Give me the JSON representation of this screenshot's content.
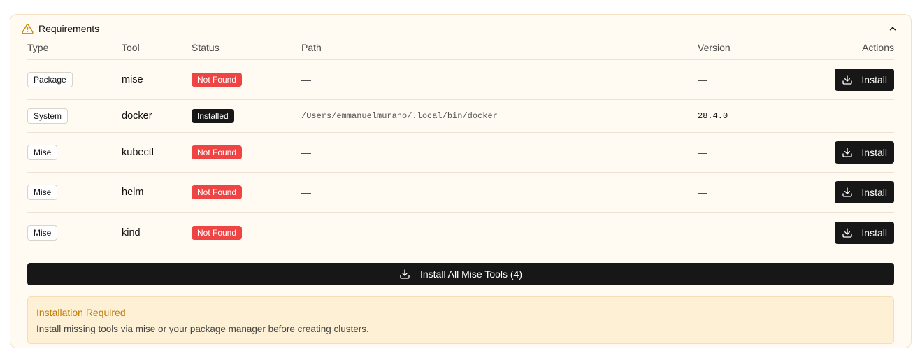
{
  "requirements": {
    "title": "Requirements",
    "columns": {
      "type": "Type",
      "tool": "Tool",
      "status": "Status",
      "path": "Path",
      "version": "Version",
      "actions": "Actions"
    },
    "rows": [
      {
        "type": "Package",
        "tool": "mise",
        "status": "Not Found",
        "path": "—",
        "version": "—",
        "action": "Install"
      },
      {
        "type": "System",
        "tool": "docker",
        "status": "Installed",
        "path": "/Users/emmanuelmurano/.local/bin/docker",
        "version": "28.4.0",
        "action": "—"
      },
      {
        "type": "Mise",
        "tool": "kubectl",
        "status": "Not Found",
        "path": "—",
        "version": "—",
        "action": "Install"
      },
      {
        "type": "Mise",
        "tool": "helm",
        "status": "Not Found",
        "path": "—",
        "version": "—",
        "action": "Install"
      },
      {
        "type": "Mise",
        "tool": "kind",
        "status": "Not Found",
        "path": "—",
        "version": "—",
        "action": "Install"
      }
    ],
    "install_all_label": "Install All Mise Tools (4)",
    "alert": {
      "title": "Installation Required",
      "description": "Install missing tools via mise or your package manager before creating clusters."
    }
  },
  "colors": {
    "not_found": "#ef4444",
    "installed": "#171717",
    "button_bg": "#171717",
    "alert_title": "#c07a07",
    "card_bg": "#fffaf2"
  },
  "icons": {
    "header": "warning-triangle-icon",
    "collapse": "chevron-up-icon",
    "install": "download-icon"
  }
}
